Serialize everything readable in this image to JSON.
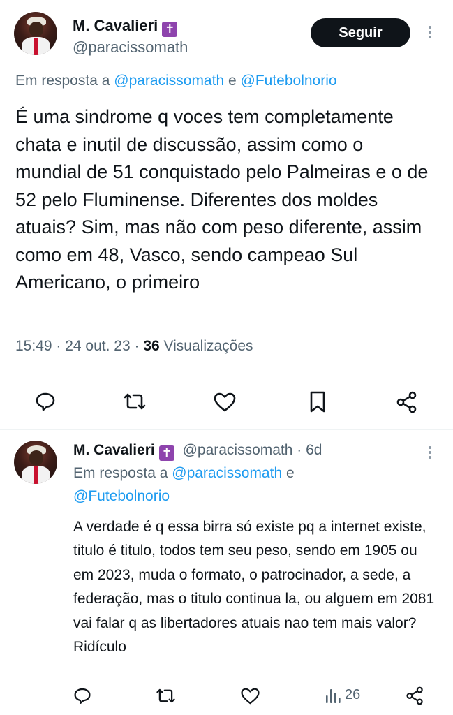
{
  "main_tweet": {
    "author_name": "M. Cavalieri",
    "badge_icon": "purple-cross-emoji",
    "handle": "@paracissomath",
    "follow_label": "Seguir",
    "reply_prefix": "Em resposta a",
    "reply_to_1": "@paracissomath",
    "reply_and": "e",
    "reply_to_2": "@Futebolnorio",
    "text": "É uma sindrome q voces tem completamente chata e inutil de discussão, assim como o mundial de 51 conquistado pelo Palmeiras e o de 52 pelo Fluminense. Diferentes dos moldes atuais? Sim, mas não com peso diferente, assim como em 48, Vasco, sendo campeao Sul Americano, o primeiro",
    "timestamp": "15:49 · 24 out. 23 ·",
    "views_count": "36",
    "views_label": "Visualizações"
  },
  "reply_tweet": {
    "author_name": "M. Cavalieri",
    "badge_icon": "purple-cross-emoji",
    "handle_time": "@paracissomath · 6d",
    "reply_prefix": "Em resposta a",
    "reply_to_1": "@paracissomath",
    "reply_and": "e",
    "reply_to_2": "@Futebolnorio",
    "text": "A verdade é q essa birra só existe pq a internet existe, titulo é titulo, todos tem seu peso, sendo em 1905 ou em 2023, muda o formato, o patrocinador, a sede, a federação, mas o titulo continua la, ou alguem em 2081 vai falar q as libertadores atuais nao tem mais valor? Ridículo",
    "views_count": "26"
  },
  "colors": {
    "accent": "#1d9bf0",
    "text": "#0f1419",
    "muted": "#536471",
    "badge": "#8e44ad",
    "follow_bg": "#0f1419"
  }
}
